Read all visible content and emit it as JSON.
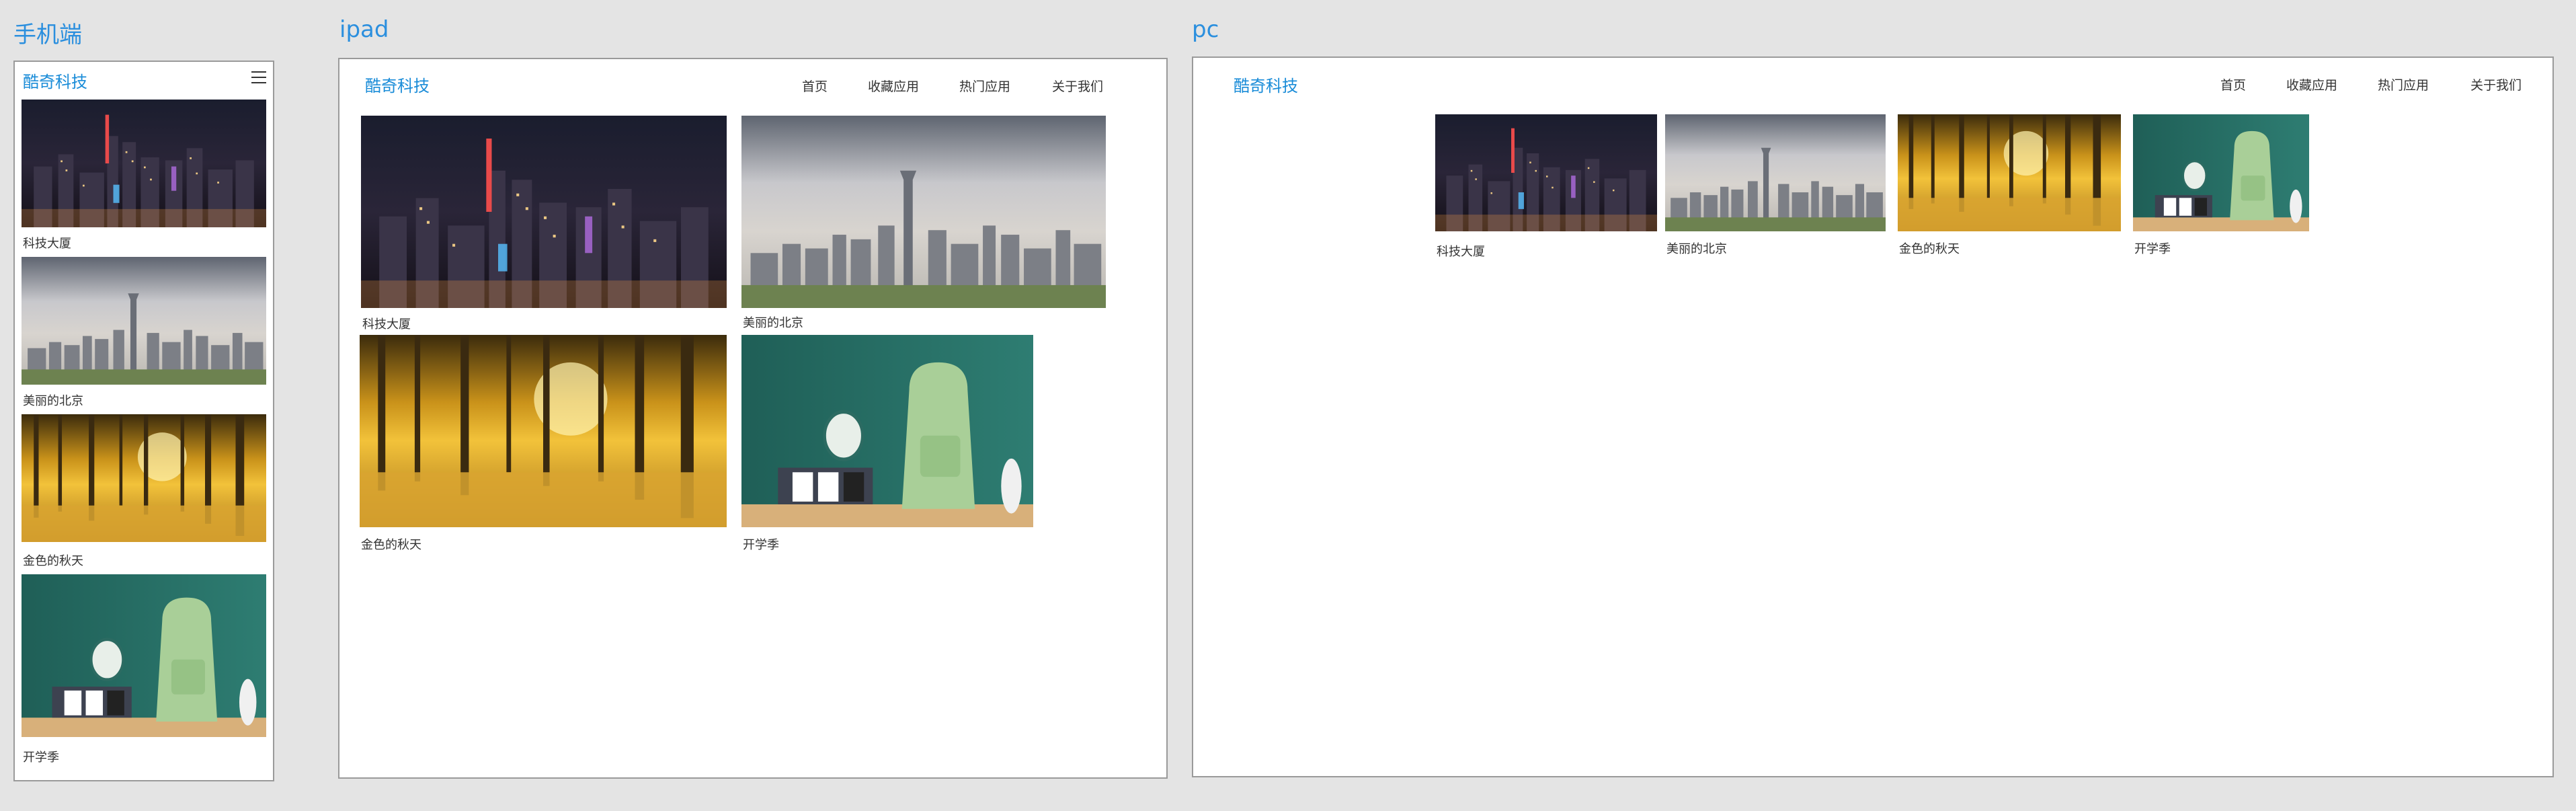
{
  "headers": {
    "mobile": "手机端",
    "ipad": "ipad",
    "pc": "pc"
  },
  "site": {
    "brand": "酷奇科技",
    "nav": [
      "首页",
      "收藏应用",
      "热门应用",
      "关于我们"
    ],
    "menu_icon": "hamburger-menu-icon"
  },
  "cards": [
    {
      "caption": "科技大厦",
      "image": "night-city-skyline"
    },
    {
      "caption": "美丽的北京",
      "image": "beijing-skyline-tower"
    },
    {
      "caption": "金色的秋天",
      "image": "golden-autumn-forest"
    },
    {
      "caption": "开学季",
      "image": "backpack-alarm-clock-chalkboard"
    }
  ]
}
